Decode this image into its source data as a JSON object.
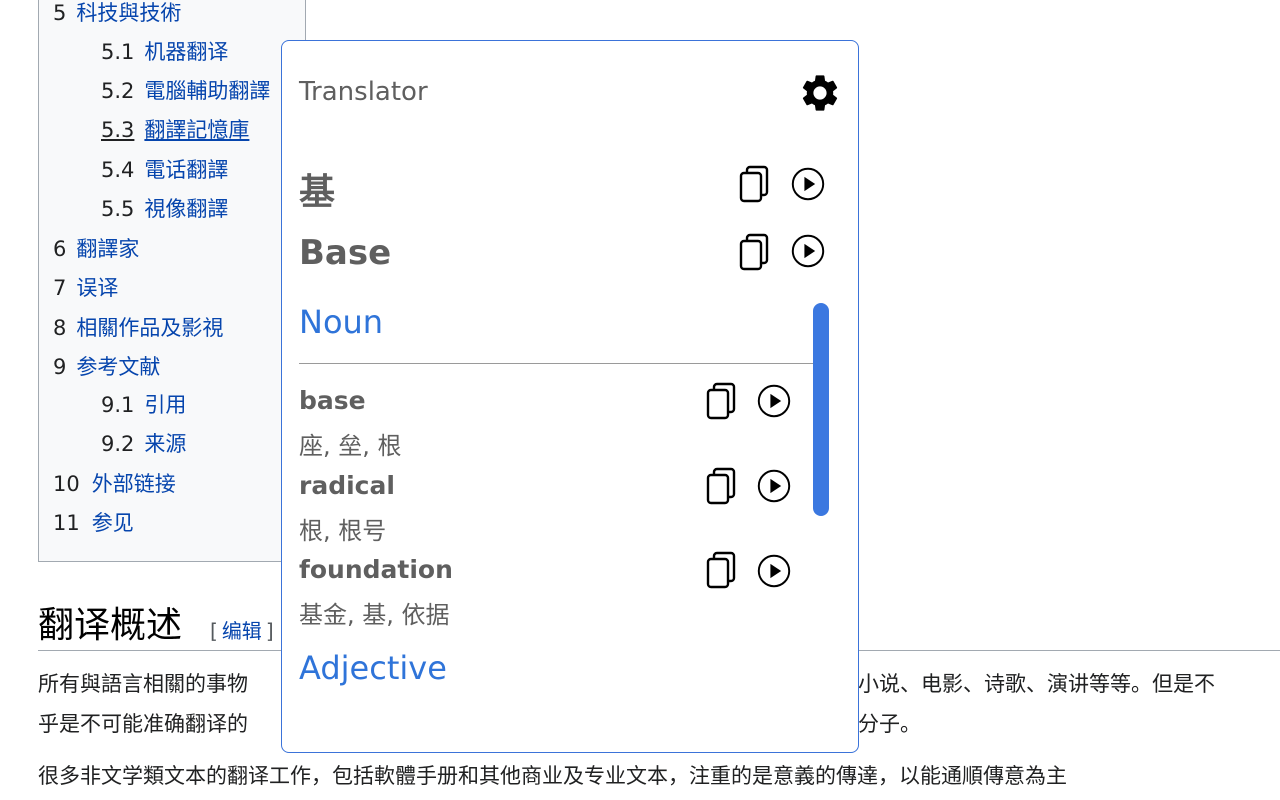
{
  "toc": [
    {
      "num": "5",
      "text": "科技與技術",
      "level": 1
    },
    {
      "num": "5.1",
      "text": "机器翻译",
      "level": 2
    },
    {
      "num": "5.2",
      "text": "電腦輔助翻譯",
      "level": 2
    },
    {
      "num": "5.3",
      "text": "翻譯記憶庫",
      "level": 2
    },
    {
      "num": "5.4",
      "text": "電话翻譯",
      "level": 2
    },
    {
      "num": "5.5",
      "text": "視像翻譯",
      "level": 2
    },
    {
      "num": "6",
      "text": "翻譯家",
      "level": 1
    },
    {
      "num": "7",
      "text": "误译",
      "level": 1
    },
    {
      "num": "8",
      "text": "相關作品及影視",
      "level": 1
    },
    {
      "num": "9",
      "text": "参考文献",
      "level": 1
    },
    {
      "num": "9.1",
      "text": "引用",
      "level": 2
    },
    {
      "num": "9.2",
      "text": "来源",
      "level": 2
    },
    {
      "num": "10",
      "text": "外部链接",
      "level": 1
    },
    {
      "num": "11",
      "text": "参见",
      "level": 1
    }
  ],
  "article": {
    "heading": "翻译概述",
    "edit_open": "[",
    "edit_label": "编辑",
    "edit_close": "]",
    "line1_left": "所有與語言相關的事物",
    "line1_right": "小说、电影、诗歌、演讲等等。但是不",
    "line2_left": "乎是不可能准确翻译的",
    "line2_right": "分子。",
    "line3": "很多非文学類文本的翻译工作，包括軟體手册和其他商业及专业文本，注重的是意義的傳達，以能通順傳意為主"
  },
  "popup": {
    "title": "Translator",
    "source_term": "基",
    "target_term": "Base",
    "sections": [
      {
        "pos": "Noun",
        "entries": [
          {
            "word": "base",
            "translations": "座, 垒, 根"
          },
          {
            "word": "radical",
            "translations": "根, 根号"
          },
          {
            "word": "foundation",
            "translations": "基金, 基, 依据"
          }
        ]
      },
      {
        "pos": "Adjective",
        "entries": []
      }
    ]
  },
  "colors": {
    "link": "#0645ad",
    "accent": "#2f74d9",
    "popup_border": "#3b73d9",
    "scrollbar": "#3b78e0"
  },
  "icons": [
    "gear-icon",
    "copy-icon",
    "play-icon"
  ]
}
